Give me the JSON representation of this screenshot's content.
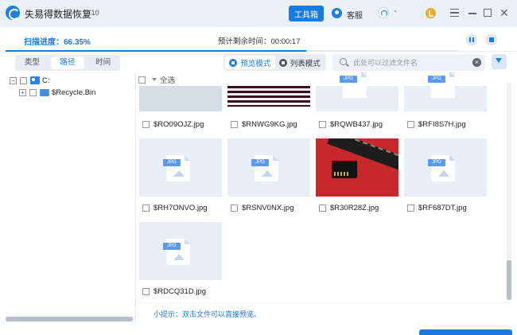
{
  "app": {
    "title": "失易得数据恢复",
    "version": "7.10"
  },
  "titlebar": {
    "toolbox_label": "工具箱",
    "service_label": "客服",
    "dot": "·"
  },
  "progress": {
    "scan_label": "扫描进度：66.35%",
    "scan_percent": 66.35,
    "remaining_label": "预计剩余时间：00:00:17"
  },
  "filter_tabs": [
    {
      "label": "类型",
      "active": false
    },
    {
      "label": "路径",
      "active": true
    },
    {
      "label": "时间",
      "active": false
    }
  ],
  "view_modes": {
    "preview_label": "预览模式",
    "list_label": "列表模式",
    "active": "preview"
  },
  "search": {
    "placeholder": "此处可以过滤文件名",
    "value": ""
  },
  "tree": [
    {
      "label": "C:",
      "type": "drive",
      "expander": "−"
    },
    {
      "label": "$Recycle.Bin",
      "type": "folder",
      "expander": "+"
    }
  ],
  "grid": {
    "select_all_label": "全选",
    "files": [
      {
        "name": "$RO09OJZ.jpg",
        "thumb": "gray"
      },
      {
        "name": "$RNWG9KG.jpg",
        "thumb": "stripes"
      },
      {
        "name": "$RQWB437.jpg",
        "thumb": "placeholder"
      },
      {
        "name": "$RFI8S7H.jpg",
        "thumb": "placeholder"
      },
      {
        "name": "$RH7ONVO.jpg",
        "thumb": "placeholder"
      },
      {
        "name": "$RSNV0NX.jpg",
        "thumb": "placeholder"
      },
      {
        "name": "$R30R28Z.jpg",
        "thumb": "photo"
      },
      {
        "name": "$RF687DT.jpg",
        "thumb": "placeholder"
      },
      {
        "name": "$RDCQ31D.jpg",
        "thumb": "placeholder"
      }
    ]
  },
  "hint": "小提示：双击文件可以直接预览。",
  "icons": [
    "app-logo-icon",
    "service-icon",
    "headset-icon",
    "vip-icon",
    "menu-icon",
    "minimize-icon",
    "maximize-icon",
    "close-icon",
    "pause-icon",
    "stop-icon",
    "grid-view-icon",
    "list-view-icon",
    "search-icon",
    "clear-icon",
    "filter-icon",
    "drive-icon",
    "folder-icon",
    "jpg-file-icon"
  ],
  "colors": {
    "accent": "#1a7be0",
    "titlebar": "#eaf0f7",
    "thumb_bg": "#e7eef7"
  }
}
